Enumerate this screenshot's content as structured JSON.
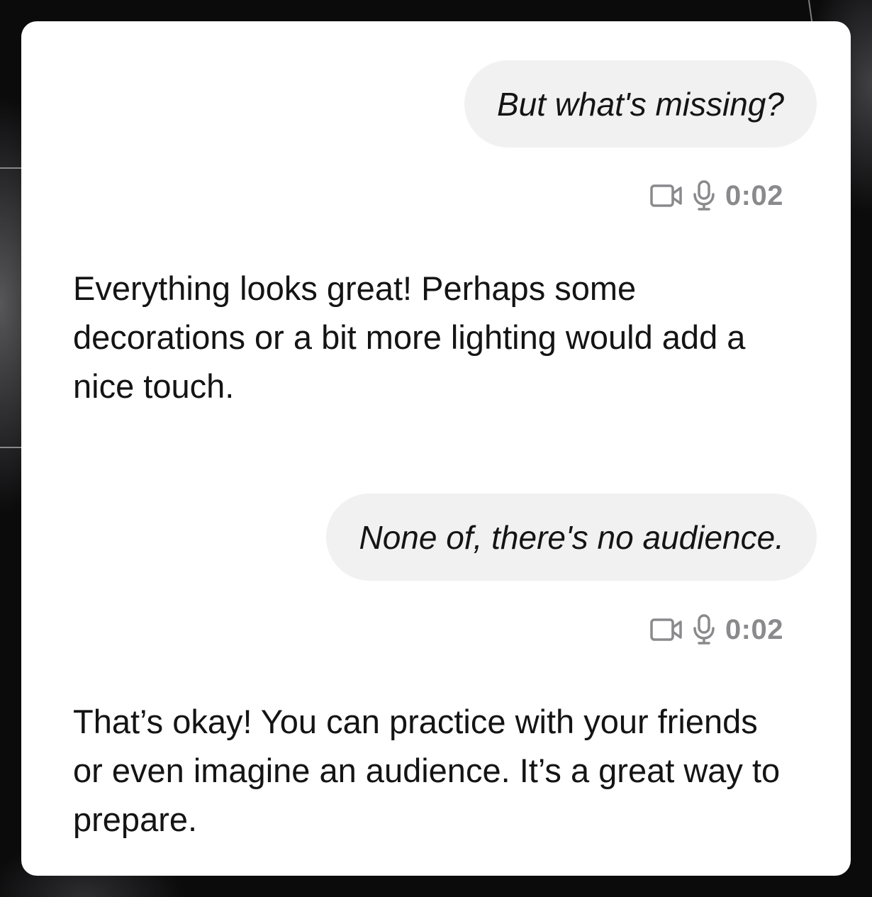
{
  "messages": [
    {
      "role": "user",
      "text": "But what's missing?",
      "video_icon": "video-camera-icon",
      "mic_icon": "microphone-icon",
      "duration": "0:02"
    },
    {
      "role": "assistant",
      "text": "Everything looks great! Perhaps some decorations or a bit more lighting would add a nice touch."
    },
    {
      "role": "user",
      "text": "None of, there's no audience.",
      "video_icon": "video-camera-icon",
      "mic_icon": "microphone-icon",
      "duration": "0:02"
    },
    {
      "role": "assistant",
      "text": "That’s okay! You can practice with your friends or even imagine an audience. It’s a great way to prepare."
    }
  ],
  "colors": {
    "card_background": "#ffffff",
    "user_bubble": "#f1f1f2",
    "text": "#141414",
    "meta": "#8a8a8d",
    "page_background": "#0b0b0c"
  }
}
